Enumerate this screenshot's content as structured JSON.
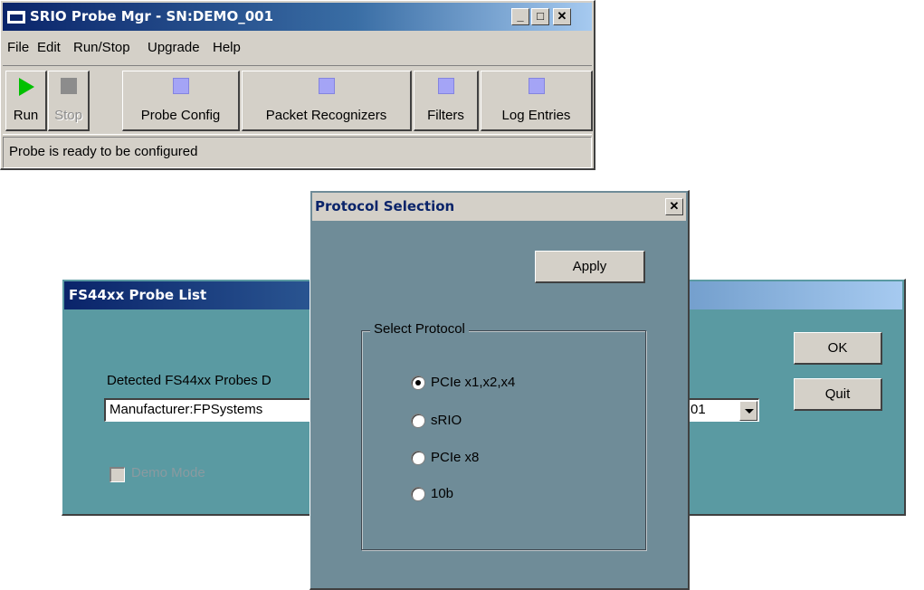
{
  "main_window": {
    "title": "SRIO Probe Mgr - SN:DEMO_001",
    "caption_buttons": {
      "minimize": "_",
      "maximize": "□",
      "close": "✕"
    },
    "menu": [
      "File",
      "Edit",
      "Run/Stop",
      "Upgrade",
      "Help"
    ],
    "toolbar": [
      {
        "label": "Run",
        "icon": "run-play-icon",
        "enabled": true
      },
      {
        "label": "Stop",
        "icon": "stop-icon",
        "enabled": false
      },
      {
        "label": "Probe Config",
        "icon": "probe-config-icon",
        "enabled": true
      },
      {
        "label": "Packet Recognizers",
        "icon": "packet-recognizers-icon",
        "enabled": true
      },
      {
        "label": "Filters",
        "icon": "filters-icon",
        "enabled": true
      },
      {
        "label": "Log Entries",
        "icon": "log-entries-icon",
        "enabled": true
      }
    ],
    "status": "Probe is ready to be configured"
  },
  "probe_list": {
    "title": "FS44xx Probe List",
    "detected_label": "Detected FS44xx Probes D",
    "combo_value_left": "Manufacturer:FPSystems",
    "combo_value_right": "01",
    "demo_mode_label": "Demo Mode",
    "ok_label": "OK",
    "quit_label": "Quit"
  },
  "protocol_dialog": {
    "title": "Protocol Selection",
    "close": "✕",
    "apply_label": "Apply",
    "group_label": "Select Protocol",
    "options": [
      "PCIe x1,x2,x4",
      "sRIO",
      "PCIe x8",
      "10b"
    ],
    "selected": "PCIe x1,x2,x4"
  },
  "colors": {
    "titlebar_active": "#0a246a",
    "face": "#d4d0c8",
    "probe_bg": "#5a9aa2",
    "dialog_bg": "#6f8c98",
    "toolbar_square": "#a4a4f6",
    "run_green": "#00c000"
  }
}
